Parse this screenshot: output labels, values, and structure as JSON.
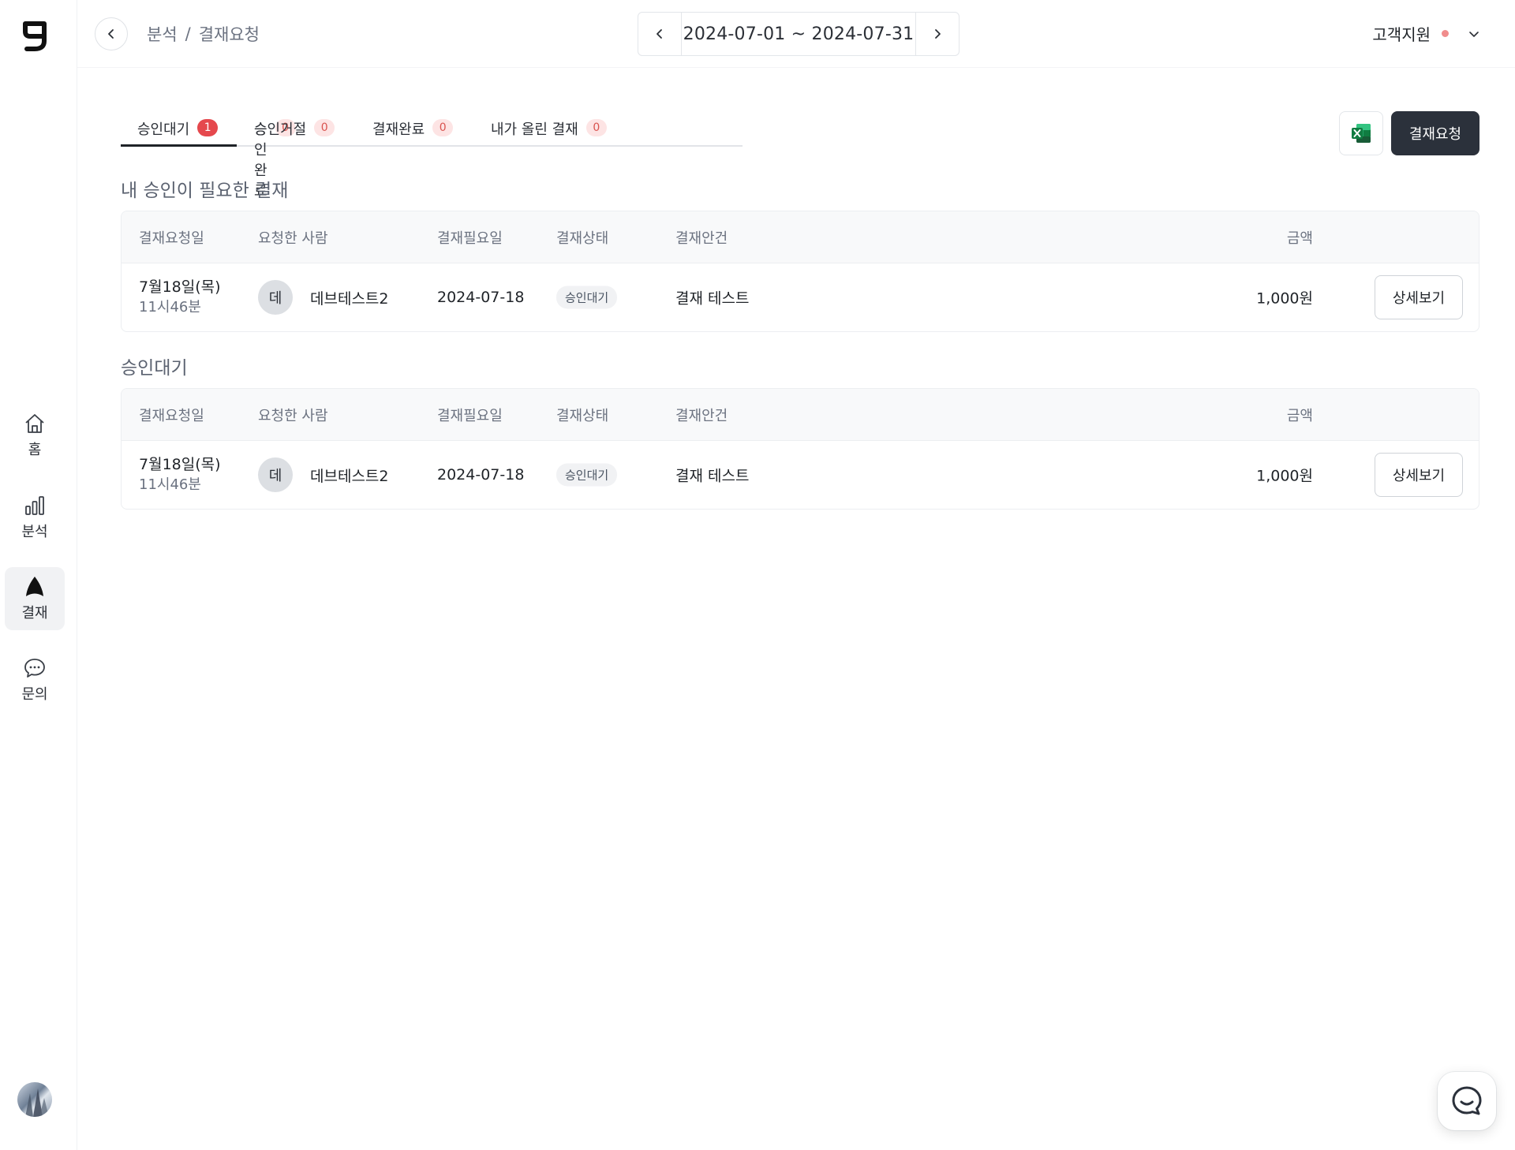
{
  "header": {
    "breadcrumb": [
      "분석",
      "결재요청"
    ],
    "breadcrumb_sep": "/",
    "date_range": "2024-07-01 ~ 2024-07-31",
    "support_label": "고객지원"
  },
  "sidebar": {
    "items": [
      {
        "label": "홈",
        "icon": "home-icon"
      },
      {
        "label": "분석",
        "icon": "bar-chart-icon"
      },
      {
        "label": "결재",
        "icon": "approval-icon",
        "active": true
      },
      {
        "label": "문의",
        "icon": "chat-bubble-icon"
      }
    ]
  },
  "tabs": [
    {
      "label": "승인대기",
      "count": "1"
    },
    {
      "label": "승인완료",
      "count": "0"
    },
    {
      "label": "승인거절",
      "count": "0"
    },
    {
      "label": "결재완료",
      "count": "0"
    },
    {
      "label": "내가 올린 결재",
      "count": "0"
    }
  ],
  "actions": {
    "request_label": "결재요청",
    "excel_icon": "excel-icon"
  },
  "columns": [
    "결재요청일",
    "요청한 사람",
    "결재필요일",
    "결재상태",
    "결재안건",
    "금액"
  ],
  "sections": [
    {
      "title": "내 승인이 필요한 결재",
      "rows": [
        {
          "date": "7월18일(목)",
          "time": "11시46분",
          "requester_initial": "데",
          "requester": "데브테스트2",
          "need_date": "2024-07-18",
          "status": "승인대기",
          "subject": "결재 테스트",
          "amount": "1,000원",
          "detail_label": "상세보기"
        }
      ]
    },
    {
      "title": "승인대기",
      "rows": [
        {
          "date": "7월18일(목)",
          "time": "11시46분",
          "requester_initial": "데",
          "requester": "데브테스트2",
          "need_date": "2024-07-18",
          "status": "승인대기",
          "subject": "결재 테스트",
          "amount": "1,000원",
          "detail_label": "상세보기"
        }
      ]
    }
  ],
  "colors": {
    "primary_dark": "#2b313b",
    "badge_red": "#e5484d",
    "badge_pale": "#fde4e4",
    "support_dot": "#f08c8c"
  }
}
